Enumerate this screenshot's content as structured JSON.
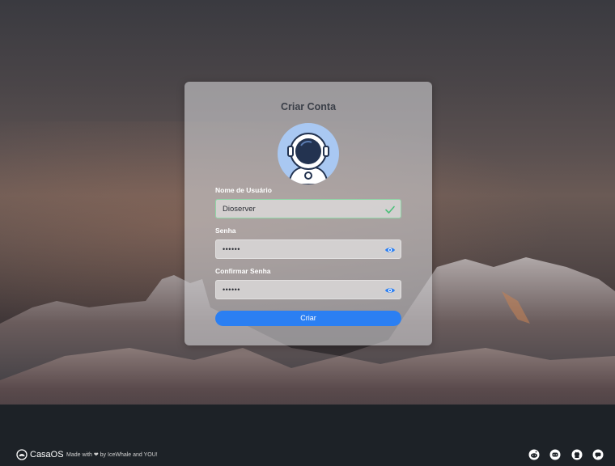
{
  "title": "Criar Conta",
  "fields": {
    "username": {
      "label": "Nome de Usuário",
      "value": "Dioserver",
      "status_icon": "check-icon"
    },
    "password": {
      "label": "Senha",
      "value": "••••••",
      "toggle_icon": "eye-icon"
    },
    "confirm": {
      "label": "Confirmar Senha",
      "value": "••••••",
      "toggle_icon": "eye-icon"
    }
  },
  "submit_label": "Criar",
  "footer": {
    "brand": "CasaOS",
    "made_with": "Made with ❤ by IceWhale and YOU!",
    "social_icons": [
      "reddit-icon",
      "discord-icon",
      "github-icon",
      "chat-icon"
    ]
  },
  "colors": {
    "accent": "#2b7ff2",
    "valid": "#4cc07a",
    "avatar_bg": "#a9c8f2"
  }
}
